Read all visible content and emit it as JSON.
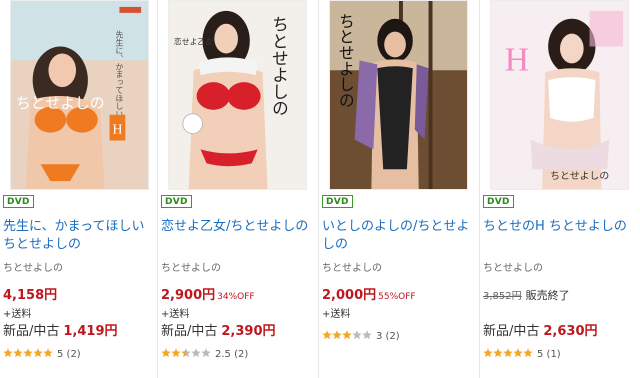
{
  "products": [
    {
      "format": "DVD",
      "title": "先生に、かまってほしいちとせよしの",
      "artist": "ちとせよしの",
      "price": "4,158円",
      "discount": "",
      "old_price": "",
      "status": "",
      "shipping": "+送料",
      "used_label": "新品/中古",
      "used_price": "1,419円",
      "stars": 5,
      "rating_text": "5 (2)",
      "cover": {
        "text1": "先生に、かまってほしい",
        "text2": "ちとせよしの",
        "text3": "H",
        "bg": "#f7e3d4",
        "accent": "#f07020"
      }
    },
    {
      "format": "DVD",
      "title": "恋せよ乙女/ちとせよしの",
      "artist": "ちとせよしの",
      "price": "2,900円",
      "discount": "34%OFF",
      "old_price": "",
      "status": "",
      "shipping": "+送料",
      "used_label": "新品/中古",
      "used_price": "2,390円",
      "stars": 2.5,
      "rating_text": "2.5 (2)",
      "cover": {
        "text1": "恋せよ乙女",
        "text2": "ちとせよしの",
        "text3": "",
        "bg": "#f4f1ee",
        "accent": "#d8202a"
      }
    },
    {
      "format": "DVD",
      "title": "いとしのよしの/ちとせよしの",
      "artist": "ちとせよしの",
      "price": "2,000円",
      "discount": "55%OFF",
      "old_price": "",
      "status": "",
      "shipping": "+送料",
      "used_label": "",
      "used_price": "",
      "stars": 3,
      "rating_text": "3 (2)",
      "cover": {
        "text1": "",
        "text2": "ちとせよしの",
        "text3": "",
        "bg": "#7a5a3c",
        "accent": "#222222"
      }
    },
    {
      "format": "DVD",
      "title": "ちとせのH ちとせよしの",
      "artist": "ちとせよしの",
      "price": "",
      "discount": "",
      "old_price": "3,852円",
      "status": "販売終了",
      "shipping": "",
      "used_label": "新品/中古",
      "used_price": "2,630円",
      "stars": 5,
      "rating_text": "5 (1)",
      "cover": {
        "text1": "",
        "text2": "ちとせよしの",
        "text3": "H",
        "bg": "#f6eef2",
        "accent": "#e05a9a"
      }
    }
  ]
}
